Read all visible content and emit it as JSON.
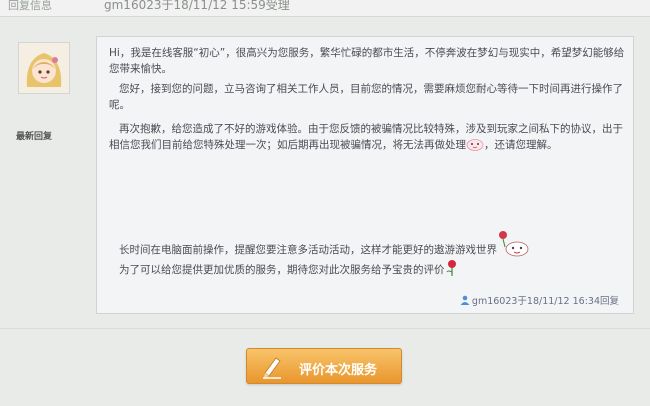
{
  "header": {
    "label": "回复信息",
    "value": "gm16023于18/11/12 15:59受理"
  },
  "reply": {
    "author_label": "最新回复",
    "paragraphs": [
      "Hi，我是在线客服“初心”，很高兴为您服务，繁华忙碌的都市生活，不停奔波在梦幻与现实中，希望梦幻能够给您带来愉快。",
      "您好，接到您的问题，立马咨询了相关工作人员，目前您的情况，需要麻烦您耐心等待一下时间再进行操作了呢。",
      "再次抱歉，给您造成了不好的游戏体验。由于您反馈的被骗情况比较特殊，涉及到玩家之间私下的协议，出于相信您我们目前给您特殊处理一次；如后期再出现被骗情况，将无法再做处理",
      "，还请您理解。",
      "长时间在电脑面前操作，提醒您要注意多活动活动，这样才能更好的遨游游戏世界",
      "为了可以给您提供更加优质的服务，期待您对此次服务给予宝贵的评价"
    ],
    "meta": "gm16023于18/11/12 16:34回复"
  },
  "actions": {
    "rate_label": "评价本次服务"
  },
  "icons": {
    "avatar": "avatar-girl",
    "emoji_1": "cute-face-icon",
    "emoji_2": "flower-face-icon",
    "emoji_3": "rose-icon",
    "user": "user-icon",
    "pencil": "pencil-icon"
  },
  "colors": {
    "button": "#e9962d",
    "link_text": "#4a5aa8"
  }
}
